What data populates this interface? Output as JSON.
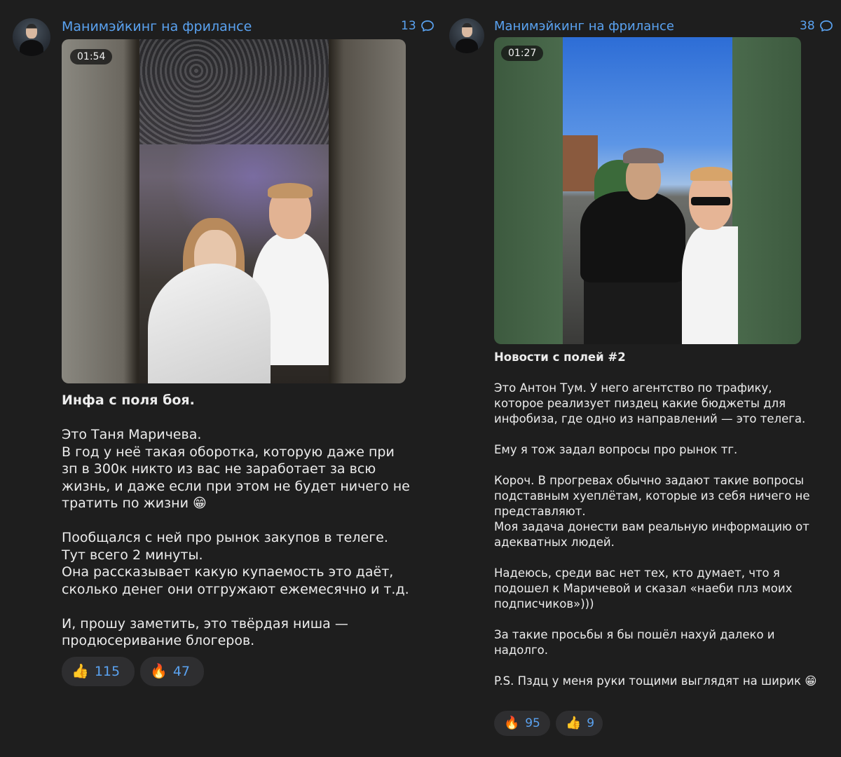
{
  "posts": [
    {
      "channel_name": "Манимэйкинг на фрилансе",
      "comments_count": "13",
      "video_duration": "01:54",
      "title": "Инфа с поля боя.",
      "body": "Это Таня Маричева.\nВ год у неё такая оборотка, которую даже при зп в 300к никто из вас не заработает за всю жизнь, и даже если при этом не будет ничего не тратить по жизни 😁\n\nПообщался с ней про рынок закупов в телеге.\nТут всего 2 минуты.\nОна рассказывает какую купаемость это даёт, сколько денег они отгружают ежемесячно и т.д.\n\nИ, прошу заметить, это твёрдая ниша — продюсеривание блогеров.",
      "reactions": [
        {
          "emoji": "👍",
          "count": "115"
        },
        {
          "emoji": "🔥",
          "count": "47"
        }
      ]
    },
    {
      "channel_name": "Манимэйкинг на фрилансе",
      "comments_count": "38",
      "video_duration": "01:27",
      "title": "Новости с полей #2",
      "body": "Это Антон Тум. У него агентство по трафику, которое реализует пиздец какие бюджеты для инфобиза, где одно из направлений — это телега.\n\nЕму я тож задал вопросы про рынок тг.\n\nКороч. В прогревах обычно задают такие вопросы подставным хуеплётам, которые из себя ничего не представляют.\nМоя задача донести вам реальную информацию от адекватных людей.\n\nНадеюсь, среди вас нет тех, кто думает, что я подошел к Маричевой и сказал «наеби плз моих подписчиков»)))\n\nЗа такие просьбы я бы пошёл нахуй далеко и надолго.\n\nP.S. Пздц у меня руки тощими выглядят на ширик 😁",
      "reactions": [
        {
          "emoji": "🔥",
          "count": "95"
        },
        {
          "emoji": "👍",
          "count": "9"
        }
      ]
    }
  ],
  "colors": {
    "background": "#1e1e1e",
    "accent": "#5aa2f0",
    "reaction_bg": "#2e2e30"
  }
}
